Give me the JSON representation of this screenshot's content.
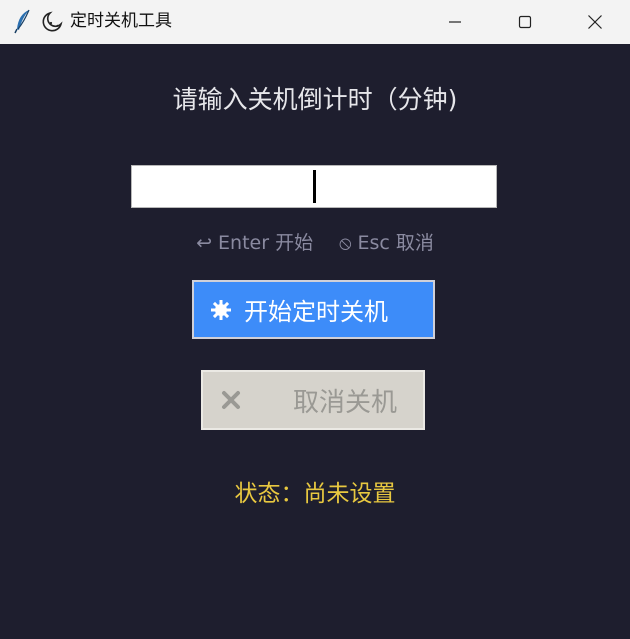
{
  "window": {
    "title": "定时关机工具",
    "app_icon": "feather-icon",
    "title_emoji": "moon-icon",
    "controls": [
      "minimize-icon",
      "maximize-icon",
      "close-icon"
    ]
  },
  "main": {
    "prompt": "请输入关机倒计时（分钟)",
    "input": {
      "value": "",
      "placeholder": ""
    },
    "hint_enter": "↩ Enter 开始",
    "hint_esc": "⦸ Esc 取消",
    "start_button": {
      "label": "开始定时关机",
      "icon": "gear-icon"
    },
    "cancel_button": {
      "label": "取消关机",
      "icon": "x-mark-icon",
      "disabled": true
    },
    "status": "状态：尚未设置"
  },
  "colors": {
    "background": "#1e1e2e",
    "titlebar": "#f3f3f3",
    "accent": "#3d8cf9",
    "status": "#e8c840",
    "hint": "#8a8aa0"
  }
}
